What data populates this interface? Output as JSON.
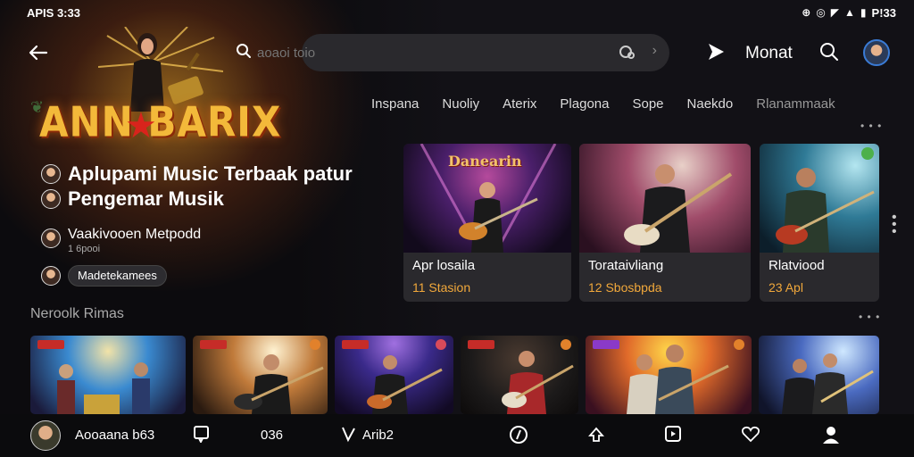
{
  "status": {
    "left": "APIS 3:33",
    "right": "P!33"
  },
  "hero": {
    "title": "ANN BARIX"
  },
  "headline": {
    "line1": "Aplupami Music Terbaak patur",
    "line2": "Pengemar Musik"
  },
  "meta": {
    "title": "Vaakivooen Metpodd",
    "subtitle": "1 6pooi"
  },
  "chip": {
    "label": "Madetekamees"
  },
  "search": {
    "placeholder": "aoaoi toio"
  },
  "header": {
    "month_label": "Monat"
  },
  "genres": [
    "Inspana",
    "Nuoliy",
    "Aterix",
    "Plagona",
    "Sope",
    "Naekdo",
    "Rlanammaak"
  ],
  "featured": [
    {
      "logo": "Danearin",
      "title": "Apr losaila",
      "sub": "11 Stasion"
    },
    {
      "title": "Torataivliang",
      "sub": "12 Sbosbpda"
    },
    {
      "title": "Rlatviood",
      "sub": "23 Apl"
    }
  ],
  "section": {
    "title": "Neroolk Rimas"
  },
  "bottom_nav": {
    "user_label": "Aooaana b63",
    "count_label": "036",
    "music_label": "Arib2"
  },
  "colors": {
    "accent": "#f1a83b",
    "card": "#2a292d",
    "background": "#121116"
  },
  "icons": [
    "back-arrow-icon",
    "search-icon",
    "voice-search-icon",
    "play-icon",
    "search-icon",
    "chat-icon",
    "music-note-icon",
    "compass-icon",
    "share-icon",
    "library-icon",
    "heart-icon",
    "profile-icon"
  ]
}
